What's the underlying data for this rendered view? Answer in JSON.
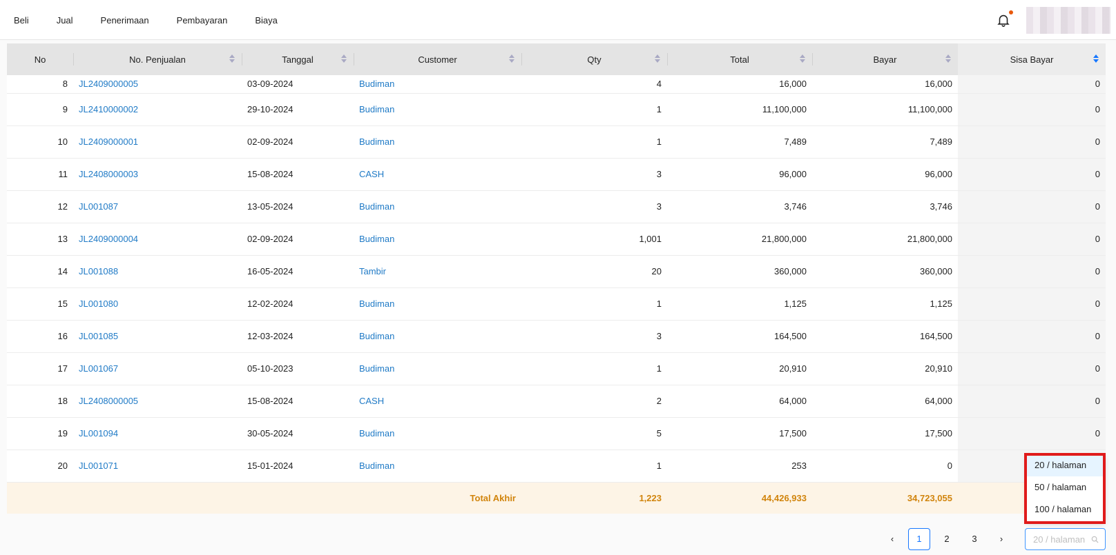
{
  "nav": {
    "items": [
      "Beli",
      "Jual",
      "Penerimaan",
      "Pembayaran",
      "Biaya"
    ]
  },
  "table": {
    "headers": [
      "No",
      "No. Penjualan",
      "Tanggal",
      "Customer",
      "Qty",
      "Total",
      "Bayar",
      "Sisa Bayar"
    ],
    "rows": [
      {
        "no": "8",
        "invoice": "JL2409000005",
        "date": "03-09-2024",
        "customer": "Budiman",
        "qty": "4",
        "total": "16,000",
        "paid": "16,000",
        "remaining": "0"
      },
      {
        "no": "9",
        "invoice": "JL2410000002",
        "date": "29-10-2024",
        "customer": "Budiman",
        "qty": "1",
        "total": "11,100,000",
        "paid": "11,100,000",
        "remaining": "0"
      },
      {
        "no": "10",
        "invoice": "JL2409000001",
        "date": "02-09-2024",
        "customer": "Budiman",
        "qty": "1",
        "total": "7,489",
        "paid": "7,489",
        "remaining": "0"
      },
      {
        "no": "11",
        "invoice": "JL2408000003",
        "date": "15-08-2024",
        "customer": "CASH",
        "qty": "3",
        "total": "96,000",
        "paid": "96,000",
        "remaining": "0"
      },
      {
        "no": "12",
        "invoice": "JL001087",
        "date": "13-05-2024",
        "customer": "Budiman",
        "qty": "3",
        "total": "3,746",
        "paid": "3,746",
        "remaining": "0"
      },
      {
        "no": "13",
        "invoice": "JL2409000004",
        "date": "02-09-2024",
        "customer": "Budiman",
        "qty": "1,001",
        "total": "21,800,000",
        "paid": "21,800,000",
        "remaining": "0"
      },
      {
        "no": "14",
        "invoice": "JL001088",
        "date": "16-05-2024",
        "customer": "Tambir",
        "qty": "20",
        "total": "360,000",
        "paid": "360,000",
        "remaining": "0"
      },
      {
        "no": "15",
        "invoice": "JL001080",
        "date": "12-02-2024",
        "customer": "Budiman",
        "qty": "1",
        "total": "1,125",
        "paid": "1,125",
        "remaining": "0"
      },
      {
        "no": "16",
        "invoice": "JL001085",
        "date": "12-03-2024",
        "customer": "Budiman",
        "qty": "3",
        "total": "164,500",
        "paid": "164,500",
        "remaining": "0"
      },
      {
        "no": "17",
        "invoice": "JL001067",
        "date": "05-10-2023",
        "customer": "Budiman",
        "qty": "1",
        "total": "20,910",
        "paid": "20,910",
        "remaining": "0"
      },
      {
        "no": "18",
        "invoice": "JL2408000005",
        "date": "15-08-2024",
        "customer": "CASH",
        "qty": "2",
        "total": "64,000",
        "paid": "64,000",
        "remaining": "0"
      },
      {
        "no": "19",
        "invoice": "JL001094",
        "date": "30-05-2024",
        "customer": "Budiman",
        "qty": "5",
        "total": "17,500",
        "paid": "17,500",
        "remaining": "0"
      },
      {
        "no": "20",
        "invoice": "JL001071",
        "date": "15-01-2024",
        "customer": "Budiman",
        "qty": "1",
        "total": "253",
        "paid": "0",
        "remaining": ""
      }
    ],
    "summary": {
      "label": "Total Akhir",
      "qty": "1,223",
      "total": "44,426,933",
      "paid": "34,723,055"
    }
  },
  "pagination": {
    "prev": "‹",
    "next": "›",
    "pages": [
      "1",
      "2",
      "3"
    ],
    "current_page": "1",
    "page_size_placeholder": "20 / halaman",
    "page_size_options": [
      "20 / halaman",
      "50 / halaman",
      "100 / halaman"
    ],
    "selected_option": "20 / halaman"
  },
  "colors": {
    "link": "#1f7ac6",
    "total": "#d1840c",
    "accent": "#1677ff",
    "highlight": "#e01b1b"
  }
}
